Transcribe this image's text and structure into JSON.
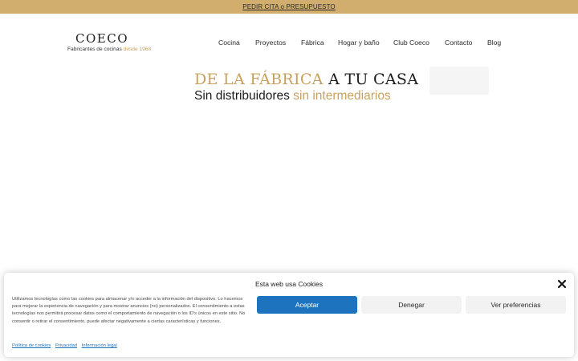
{
  "topbar": {
    "cta": "PEDIR CITA o PRESUPUESTO"
  },
  "logo": {
    "brand": "COECO",
    "tagline": "Fabricantes de cocinas",
    "tagline_year": "desde 1968"
  },
  "nav": {
    "items": [
      "Cocina",
      "Proyectos",
      "Fábrica",
      "Hogar y baño",
      "Club Coeco",
      "Contacto",
      "Blog"
    ]
  },
  "hero": {
    "line1_gold": "DE LA FÁBRICA",
    "line1_dark": "A TU CASA",
    "line2_dark": "Sin distribuidores",
    "line2_gold": "sin intermediarios"
  },
  "cookie": {
    "title": "Esta web usa Cookies",
    "text": "Utilizamos tecnologías como las cookies para almacenar y/o acceder a la información del dispositivo. Lo hacemos para mejorar la experiencia de navegación y para mostrar anuncios (no) personalizados. El consentimiento a estas tecnologías nos permitirá procesar datos como el comportamiento de navegación o los ID's únicos en este sitio. No consentir o retirar el consentimiento, puede afectar negativamente a ciertas características y funciones.",
    "accept": "Aceptar",
    "deny": "Denegar",
    "prefs": "Ver preferencias",
    "links": [
      "Política de cookies",
      "Privacidad",
      "Información legal"
    ]
  },
  "colors": {
    "gold": "#c9a15d",
    "topbar": "#d1ad6e",
    "accent_blue": "#1e73be"
  }
}
